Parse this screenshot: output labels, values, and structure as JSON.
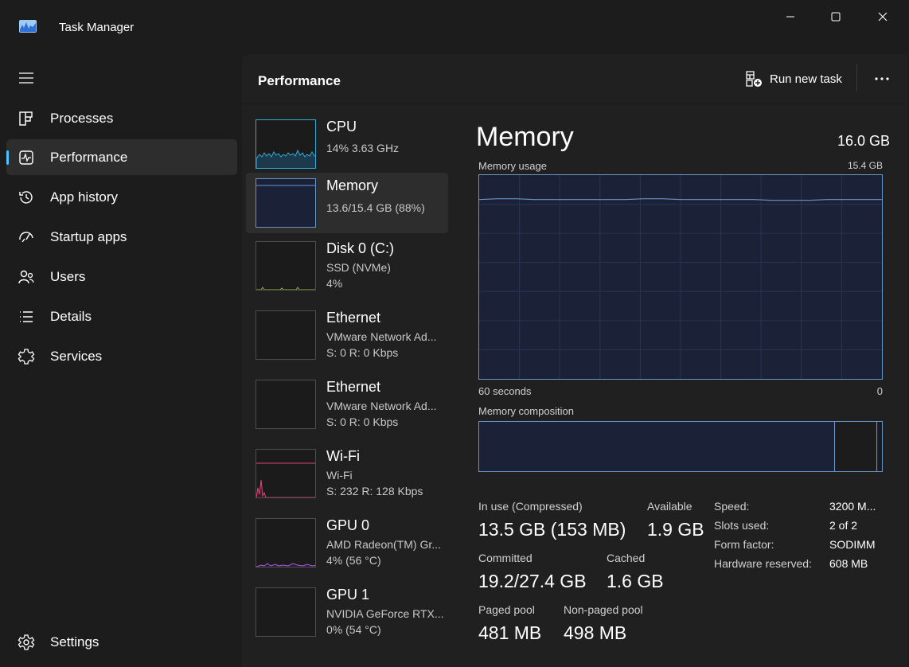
{
  "window": {
    "title": "Task Manager"
  },
  "colors": {
    "accent": "#4cc2ff",
    "memory_line": "#6a94c6",
    "memory_fill": "#1b2237",
    "cpu_line": "#2ea9d8",
    "wifi_line": "#e0457a",
    "gpu_line": "#b25ce0",
    "disk_line": "#8fb33a"
  },
  "icons": {
    "app": "task-manager-icon",
    "minimize": "minimize-icon",
    "maximize": "maximize-icon",
    "close": "close-icon"
  },
  "sidebar": {
    "items": [
      {
        "label": "Processes",
        "icon": "processes-icon"
      },
      {
        "label": "Performance",
        "icon": "performance-icon",
        "active": true
      },
      {
        "label": "App history",
        "icon": "app-history-icon"
      },
      {
        "label": "Startup apps",
        "icon": "startup-icon"
      },
      {
        "label": "Users",
        "icon": "users-icon"
      },
      {
        "label": "Details",
        "icon": "details-icon"
      },
      {
        "label": "Services",
        "icon": "services-icon"
      }
    ],
    "settings": {
      "label": "Settings",
      "icon": "settings-icon"
    }
  },
  "header": {
    "title": "Performance",
    "run_task_label": "Run new task"
  },
  "devices": [
    {
      "name": "CPU",
      "line1": "14% 3.63 GHz"
    },
    {
      "name": "Memory",
      "line1": "13.6/15.4 GB (88%)"
    },
    {
      "name": "Disk 0 (C:)",
      "line1": "SSD (NVMe)",
      "line2": "4%"
    },
    {
      "name": "Ethernet",
      "line1": "VMware Network Ad...",
      "line2": "S: 0 R: 0 Kbps"
    },
    {
      "name": "Ethernet",
      "line1": "VMware Network Ad...",
      "line2": "S: 0 R: 0 Kbps"
    },
    {
      "name": "Wi-Fi",
      "line1": "Wi-Fi",
      "line2": "S: 232 R: 128 Kbps"
    },
    {
      "name": "GPU 0",
      "line1": "AMD Radeon(TM) Gr...",
      "line2": "4% (56 °C)"
    },
    {
      "name": "GPU 1",
      "line1": "NVIDIA GeForce RTX...",
      "line2": "0% (54 °C)"
    }
  ],
  "memory": {
    "title": "Memory",
    "total": "16.0 GB",
    "usage_label": "Memory usage",
    "usage_max": "15.4 GB",
    "time_left": "60 seconds",
    "time_right": "0",
    "usage_fraction": 0.88,
    "composition_label": "Memory composition",
    "stats": {
      "in_use_label": "In use (Compressed)",
      "in_use_value": "13.5 GB (153 MB)",
      "available_label": "Available",
      "available_value": "1.9 GB",
      "committed_label": "Committed",
      "committed_value": "19.2/27.4 GB",
      "cached_label": "Cached",
      "cached_value": "1.6 GB",
      "paged_label": "Paged pool",
      "paged_value": "481 MB",
      "nonpaged_label": "Non-paged pool",
      "nonpaged_value": "498 MB"
    },
    "specs": {
      "speed_label": "Speed:",
      "speed_value": "3200 M...",
      "slots_label": "Slots used:",
      "slots_value": "2 of 2",
      "form_label": "Form factor:",
      "form_value": "SODIMM",
      "reserved_label": "Hardware reserved:",
      "reserved_value": "608 MB"
    }
  }
}
